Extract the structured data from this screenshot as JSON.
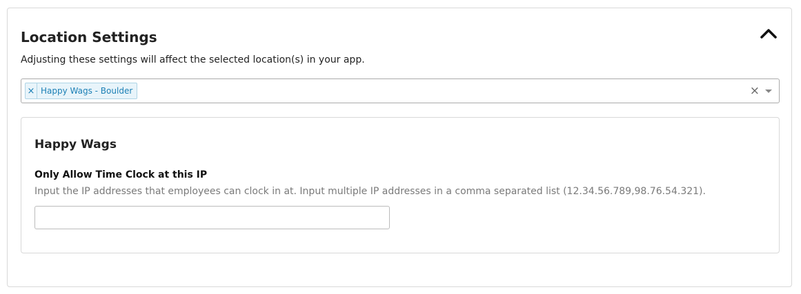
{
  "panel": {
    "title": "Location Settings",
    "description": "Adjusting these settings will affect the selected location(s) in your app.",
    "collapse_icon": "chevron-up-icon"
  },
  "location_select": {
    "selected_tags": [
      {
        "remove_glyph": "×",
        "label": "Happy Wags - Boulder"
      }
    ],
    "clear_glyph": "×",
    "arrow_icon": "caret-down-icon"
  },
  "card": {
    "title": "Happy Wags",
    "field": {
      "label": "Only Allow Time Clock at this IP",
      "help": "Input the IP addresses that employees can clock in at. Input multiple IP addresses in a comma separated list (12.34.56.789,98.76.54.321).",
      "value": "",
      "placeholder": ""
    }
  },
  "colors": {
    "tag_background": "#e8f4fa",
    "tag_border": "#aed4e6",
    "tag_text": "#1b7fb5",
    "help_text": "#7a7a7a",
    "border": "#d8d8d8"
  }
}
